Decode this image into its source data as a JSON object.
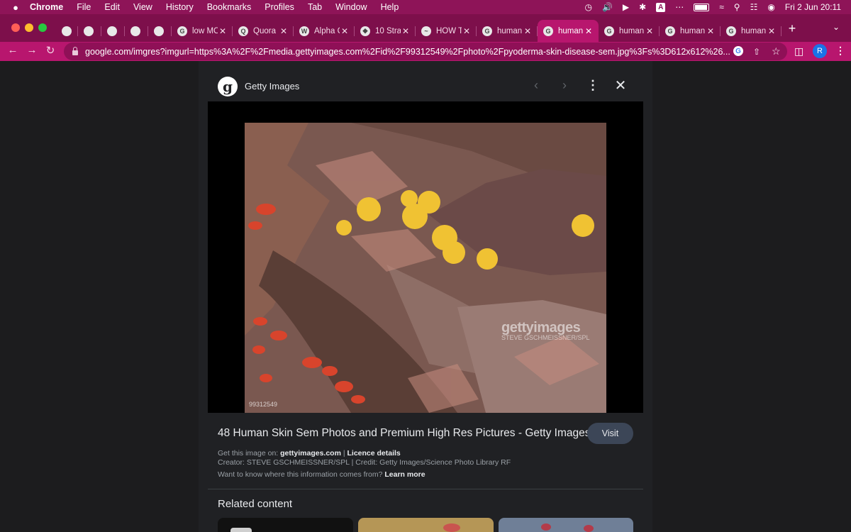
{
  "menubar": {
    "app": "Chrome",
    "items": [
      "File",
      "Edit",
      "View",
      "History",
      "Bookmarks",
      "Profiles",
      "Tab",
      "Window",
      "Help"
    ],
    "status_a_label": "A",
    "datetime": "Fri 2 Jun  20:11"
  },
  "tabs": [
    {
      "label": "",
      "icon": "globe-icon",
      "fav": ""
    },
    {
      "label": "",
      "icon": "sheet-icon",
      "fav": ""
    },
    {
      "label": "",
      "icon": "dot-icon",
      "fav": ""
    },
    {
      "label": "",
      "icon": "slack-icon",
      "fav": ""
    },
    {
      "label": "",
      "icon": "chat-icon",
      "fav": ""
    },
    {
      "label": "low MC",
      "icon": "google-icon",
      "fav": "G"
    },
    {
      "label": "Quora",
      "icon": "quora-icon",
      "fav": "Q"
    },
    {
      "label": "Alpha C",
      "icon": "wordpress-icon",
      "fav": "W"
    },
    {
      "label": "10 Stra",
      "icon": "ethereum-icon",
      "fav": "◆"
    },
    {
      "label": "HOW T",
      "icon": "site-icon",
      "fav": "~"
    },
    {
      "label": "human",
      "icon": "google-icon",
      "fav": "G"
    },
    {
      "label": "human",
      "icon": "google-icon",
      "fav": "G",
      "active": true
    },
    {
      "label": "human",
      "icon": "google-icon",
      "fav": "G"
    },
    {
      "label": "human",
      "icon": "google-icon",
      "fav": "G"
    },
    {
      "label": "human",
      "icon": "google-icon",
      "fav": "G"
    }
  ],
  "address": {
    "url": "google.com/imgres?imgurl=https%3A%2F%2Fmedia.gettyimages.com%2Fid%2F99312549%2Fphoto%2Fpyoderma-skin-disease-sem.jpg%3Fs%3D612x612%26...",
    "profile_initial": "R"
  },
  "panel": {
    "logo_letter": "g",
    "source_name": "Getty Images",
    "watermark_brand": "gettyimages",
    "watermark_credit": "STEVE GSCHMEISSNER/SPL",
    "image_id": "99312549",
    "title": "48 Human Skin Sem Photos and Premium High Res Pictures - Getty Images",
    "visit_label": "Visit",
    "get_image_prefix": "Get this image on: ",
    "get_image_site": "gettyimages.com",
    "separator": " | ",
    "licence_link": "Licence details",
    "creator_line": "Creator: STEVE GSCHMEISSNER/SPL | Credit: Getty Images/Science Photo Library RF",
    "info_prefix": "Want to know where this information comes from? ",
    "learn_more": "Learn more",
    "related_heading": "Related content"
  }
}
